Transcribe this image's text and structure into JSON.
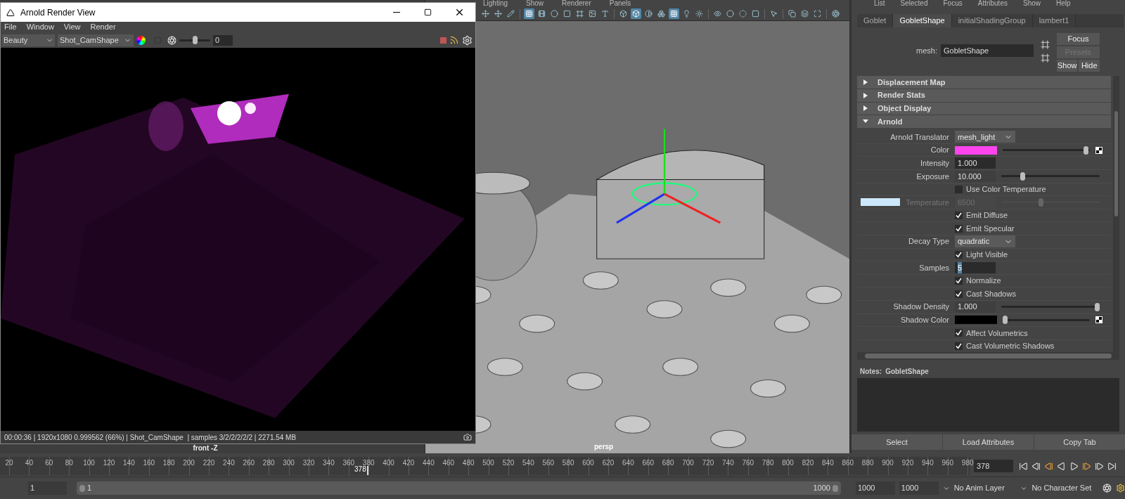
{
  "render_view": {
    "title": "Arnold Render View",
    "menu": [
      "File",
      "Window",
      "View",
      "Render"
    ],
    "aov": "Beauty",
    "camera": "Shot_CamShape",
    "exposure": {
      "level": 0.5,
      "value": "0"
    },
    "status": "00:00:36 | 1920x1080 0.999562 (66%) | Shot_CamShape  | samples 3/2/2/2/2/2 | 2271.54 MB"
  },
  "viewport": {
    "menu": [
      "Lighting",
      "Show",
      "Renderer",
      "Panels"
    ],
    "toolbar": [
      {
        "on": false
      },
      {
        "on": false
      },
      {
        "on": false
      },
      {
        "on": true
      },
      {
        "on": false
      },
      {
        "on": false
      },
      {
        "on": false
      },
      {
        "on": false
      },
      {
        "on": false
      },
      {
        "on": false
      },
      {
        "on": false
      },
      {
        "on": true
      },
      {
        "on": false
      },
      {
        "on": false
      },
      {
        "on": true
      },
      {
        "on": false
      },
      {
        "on": false
      },
      {
        "on": false
      },
      {
        "on": false
      },
      {
        "on": false
      },
      {
        "on": false
      },
      {
        "on": false
      },
      {
        "on": false
      },
      {
        "on": false
      },
      {
        "on": false
      },
      {
        "on": false
      }
    ],
    "front_label": "front -Z",
    "persp_label": "persp"
  },
  "attribute_editor": {
    "menu": [
      "List",
      "Selected",
      "Focus",
      "Attributes",
      "Show",
      "Help"
    ],
    "tabs": [
      {
        "label": "Goblet",
        "selected": false
      },
      {
        "label": "GobletShape",
        "selected": true
      },
      {
        "label": "initialShadingGroup",
        "selected": false
      },
      {
        "label": "lambert1",
        "selected": false
      }
    ],
    "node_label": "mesh:",
    "node_name": "GobletShape",
    "buttons": [
      {
        "label": "Focus",
        "disabled": false
      },
      {
        "label": "Presets",
        "disabled": true
      },
      {
        "label": "Show",
        "disabled": false
      },
      {
        "label": "Hide",
        "disabled": false
      }
    ],
    "sections": [
      {
        "title": "Displacement Map",
        "expanded": false
      },
      {
        "title": "Render Stats",
        "expanded": false
      },
      {
        "title": "Object Display",
        "expanded": false
      },
      {
        "title": "Arnold",
        "expanded": true
      }
    ],
    "attributes": [
      {
        "kind": "dropdown",
        "label": "Arnold Translator",
        "value": "mesh_light"
      },
      {
        "kind": "color",
        "label": "Color",
        "color": "#ff44ee",
        "level": 0.98
      },
      {
        "kind": "number",
        "label": "Intensity",
        "value": "1.000",
        "text_selected": false
      },
      {
        "kind": "slider",
        "label": "Exposure",
        "value": "10.000",
        "level": 0.2
      },
      {
        "kind": "checkbox",
        "label": "Use Color Temperature",
        "checked": false
      },
      {
        "kind": "temperature",
        "label": "Temperature",
        "value": "6500",
        "color": "#cde8fb",
        "level": 0.4,
        "disabled": true
      },
      {
        "kind": "checkbox",
        "label": "Emit Diffuse",
        "checked": true
      },
      {
        "kind": "checkbox",
        "label": "Emit Specular",
        "checked": true
      },
      {
        "kind": "dropdown",
        "label": "Decay Type",
        "value": "quadratic"
      },
      {
        "kind": "checkbox",
        "label": "Light Visible",
        "checked": true
      },
      {
        "kind": "number",
        "label": "Samples",
        "value": "5",
        "text_selected": true
      },
      {
        "kind": "checkbox",
        "label": "Normalize",
        "checked": true
      },
      {
        "kind": "checkbox",
        "label": "Cast Shadows",
        "checked": true
      },
      {
        "kind": "slider",
        "label": "Shadow Density",
        "value": "1.000",
        "level": 1
      },
      {
        "kind": "color",
        "label": "Shadow Color",
        "color": "#000000",
        "level": 0
      },
      {
        "kind": "checkbox",
        "label": "Affect Volumetrics",
        "checked": true
      },
      {
        "kind": "checkbox",
        "label": "Cast Volumetric Shadows",
        "checked": true
      }
    ],
    "notes_label": "Notes:",
    "notes_node": "GobletShape",
    "bottom_buttons": [
      "Select",
      "Load Attributes",
      "Copy Tab"
    ]
  },
  "timeline": {
    "ticks": [
      "20",
      "40",
      "60",
      "80",
      "100",
      "120",
      "140",
      "160",
      "180",
      "200",
      "220",
      "240",
      "260",
      "280",
      "300",
      "320",
      "340",
      "360",
      "380",
      "400",
      "420",
      "440",
      "460",
      "480",
      "500",
      "520",
      "540",
      "560",
      "580",
      "600",
      "620",
      "640",
      "660",
      "680",
      "700",
      "720",
      "740",
      "760",
      "780",
      "800",
      "820",
      "840",
      "860",
      "880",
      "900",
      "920",
      "940",
      "960",
      "980"
    ],
    "current": "378",
    "frame_field": "378"
  },
  "range": {
    "start": "1",
    "inner_start": "1",
    "inner_end": "1000",
    "end": "1000",
    "end2": "1000",
    "anim_layer": "No Anim Layer",
    "character_set": "No Character Set"
  }
}
